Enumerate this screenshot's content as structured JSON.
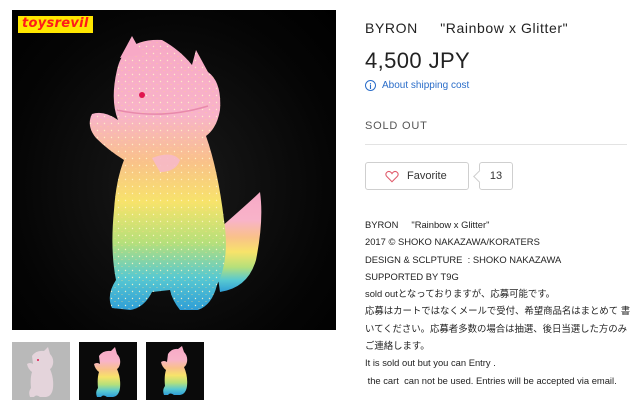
{
  "product": {
    "name": "BYRON     \"Rainbow x Glitter\"",
    "price": "4,500 JPY",
    "shipping_link": "About shipping cost",
    "status": "SOLD OUT",
    "favorite_label": "Favorite",
    "favorite_count": "13"
  },
  "gallery": {
    "logo_text": "toysrevil",
    "thumbnails": [
      "thumbnail-1",
      "thumbnail-2",
      "thumbnail-3"
    ]
  },
  "description": {
    "lines": [
      "BYRON     \"Rainbow x Glitter\"",
      "2017 © SHOKO NAKAZAWA/KORATERS",
      "DESIGN & SCLPTURE  : SHOKO NAKAZAWA",
      "SUPPORTED BY T9G",
      "sold outとなっておりますが、応募可能です。",
      "応募はカートではなくメールで受付、希望商品名はまとめて 書いてください。応募者多数の場合は抽選、後日当選した方のみ ご連絡します。",
      "It is sold out but you can Entry .",
      " the cart  can not be used. Entries will be accepted via email."
    ]
  },
  "colors": {
    "link_blue": "#2a6dc9",
    "logo_red": "#ff1a1a",
    "logo_yellow": "#ffe600"
  }
}
